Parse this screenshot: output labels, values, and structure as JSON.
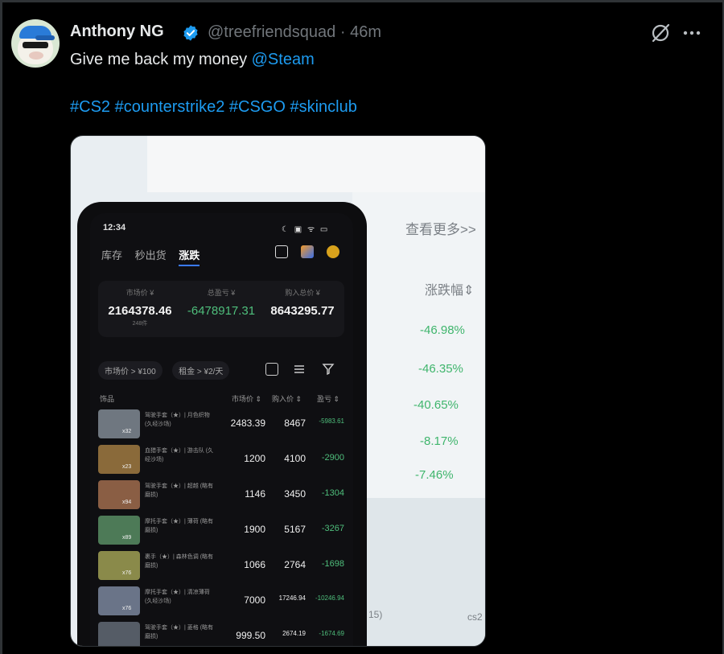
{
  "tweet": {
    "author_name": "Anthony NG",
    "handle": "@treefriendsquad",
    "separator": " · ",
    "time": "46m",
    "text": "Give me back my money ",
    "mention": "@Steam",
    "hashtags": "#CS2 #counterstrike2 #CSGO #skinclub"
  },
  "icons": {
    "verified": "verified-badge-icon",
    "grok": "grok-icon",
    "more": "more-icon"
  },
  "media": {
    "background": {
      "view_more": "查看更多>>",
      "column_header": "涨跌幅⇕",
      "percentages": [
        "-46.98%",
        "-46.35%",
        "-40.65%",
        "-8.17%",
        "-7.46%"
      ],
      "bottom_left": "15)",
      "bottom_right": "cs2"
    },
    "phone": {
      "time": "12:34",
      "status_icons": "☾ ▣ ᯤ ▭",
      "tabs": [
        "库存",
        "秒出货",
        "涨跌"
      ],
      "active_tab": "涨跌",
      "summary": {
        "market_label": "市场价 ¥",
        "market_value": "2164378.46",
        "market_sub": "248件",
        "pl_label": "总盈亏 ¥",
        "pl_value": "-6478917.31",
        "buy_label": "购入总价 ¥",
        "buy_value": "8643295.77"
      },
      "filters": [
        "市场价 > ¥100",
        "租金 > ¥2/天"
      ],
      "columns": {
        "item": "饰品",
        "market": "市场价 ⇕",
        "buy": "购入价 ⇕",
        "pl": "盈亏 ⇕"
      },
      "rows": [
        {
          "name": "驾驶手套（★）| 月色织物 (久经沙场)",
          "count": "x32",
          "price": "2483.39",
          "buy": "8467",
          "pl": "-5983.61",
          "pl_small": true
        },
        {
          "name": "血猎手套（★）| 游击队 (久经沙场)",
          "count": "x23",
          "price": "1200",
          "buy": "4100",
          "pl": "-2900",
          "pl_small": false
        },
        {
          "name": "驾驶手套（★）| 超越 (略有磨损)",
          "count": "x94",
          "price": "1146",
          "buy": "3450",
          "pl": "-1304",
          "pl_small": false
        },
        {
          "name": "摩托手套（★）| 薄荷 (略有磨损)",
          "count": "x89",
          "price": "1900",
          "buy": "5167",
          "pl": "-3267",
          "pl_small": false
        },
        {
          "name": "裹手（★）| 森林色调 (略有磨损)",
          "count": "x76",
          "price": "1066",
          "buy": "2764",
          "pl": "-1698",
          "pl_small": false
        },
        {
          "name": "摩托手套（★）| 清凉薄荷 (久经沙场)",
          "count": "x76",
          "price": "7000",
          "buy": "17246.94",
          "pl": "-10246.94",
          "pl_small": true
        },
        {
          "name": "驾驶手套（★）| 菱格 (略有磨损)",
          "count": "",
          "price": "999.50",
          "buy": "2674.19",
          "pl": "-1674.69",
          "pl_small": true
        }
      ]
    }
  }
}
